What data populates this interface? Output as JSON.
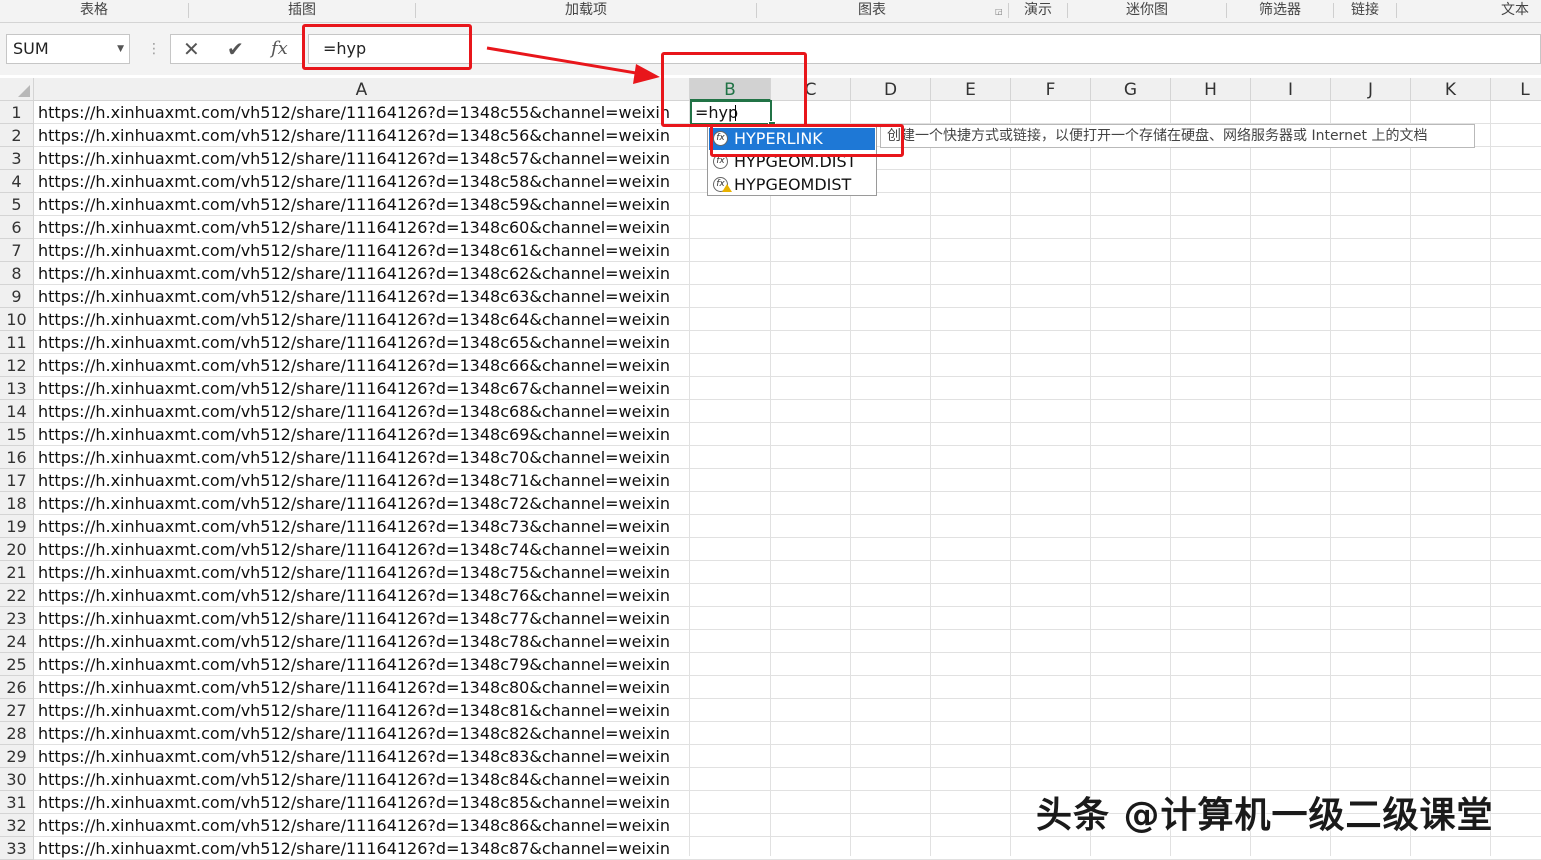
{
  "ribbon": {
    "groups": [
      {
        "label": "表格"
      },
      {
        "label": "插图"
      },
      {
        "label": "加载项"
      },
      {
        "label": "图表"
      },
      {
        "label": "演示"
      },
      {
        "label": "迷你图"
      },
      {
        "label": "筛选器"
      },
      {
        "label": "链接"
      },
      {
        "label": "文本"
      }
    ]
  },
  "formula_bar": {
    "name_box": "SUM",
    "cancel_icon": "close-icon",
    "enter_icon": "checkmark-icon",
    "function_icon": "fx-icon",
    "fx_label": "fx",
    "formula": "=hyp"
  },
  "sheet": {
    "columns": [
      "A",
      "B",
      "C",
      "D",
      "E",
      "F",
      "G",
      "H",
      "I",
      "J",
      "K",
      "L"
    ],
    "selected_column": "B",
    "active_cell": "B1",
    "active_cell_value": "=hyp",
    "rows": [
      {
        "num": "1",
        "a": "https://h.xinhuaxmt.com/vh512/share/11164126?d=1348c55&channel=weixin"
      },
      {
        "num": "2",
        "a": "https://h.xinhuaxmt.com/vh512/share/11164126?d=1348c56&channel=weixin"
      },
      {
        "num": "3",
        "a": "https://h.xinhuaxmt.com/vh512/share/11164126?d=1348c57&channel=weixin"
      },
      {
        "num": "4",
        "a": "https://h.xinhuaxmt.com/vh512/share/11164126?d=1348c58&channel=weixin"
      },
      {
        "num": "5",
        "a": "https://h.xinhuaxmt.com/vh512/share/11164126?d=1348c59&channel=weixin"
      },
      {
        "num": "6",
        "a": "https://h.xinhuaxmt.com/vh512/share/11164126?d=1348c60&channel=weixin"
      },
      {
        "num": "7",
        "a": "https://h.xinhuaxmt.com/vh512/share/11164126?d=1348c61&channel=weixin"
      },
      {
        "num": "8",
        "a": "https://h.xinhuaxmt.com/vh512/share/11164126?d=1348c62&channel=weixin"
      },
      {
        "num": "9",
        "a": "https://h.xinhuaxmt.com/vh512/share/11164126?d=1348c63&channel=weixin"
      },
      {
        "num": "10",
        "a": "https://h.xinhuaxmt.com/vh512/share/11164126?d=1348c64&channel=weixin"
      },
      {
        "num": "11",
        "a": "https://h.xinhuaxmt.com/vh512/share/11164126?d=1348c65&channel=weixin"
      },
      {
        "num": "12",
        "a": "https://h.xinhuaxmt.com/vh512/share/11164126?d=1348c66&channel=weixin"
      },
      {
        "num": "13",
        "a": "https://h.xinhuaxmt.com/vh512/share/11164126?d=1348c67&channel=weixin"
      },
      {
        "num": "14",
        "a": "https://h.xinhuaxmt.com/vh512/share/11164126?d=1348c68&channel=weixin"
      },
      {
        "num": "15",
        "a": "https://h.xinhuaxmt.com/vh512/share/11164126?d=1348c69&channel=weixin"
      },
      {
        "num": "16",
        "a": "https://h.xinhuaxmt.com/vh512/share/11164126?d=1348c70&channel=weixin"
      },
      {
        "num": "17",
        "a": "https://h.xinhuaxmt.com/vh512/share/11164126?d=1348c71&channel=weixin"
      },
      {
        "num": "18",
        "a": "https://h.xinhuaxmt.com/vh512/share/11164126?d=1348c72&channel=weixin"
      },
      {
        "num": "19",
        "a": "https://h.xinhuaxmt.com/vh512/share/11164126?d=1348c73&channel=weixin"
      },
      {
        "num": "20",
        "a": "https://h.xinhuaxmt.com/vh512/share/11164126?d=1348c74&channel=weixin"
      },
      {
        "num": "21",
        "a": "https://h.xinhuaxmt.com/vh512/share/11164126?d=1348c75&channel=weixin"
      },
      {
        "num": "22",
        "a": "https://h.xinhuaxmt.com/vh512/share/11164126?d=1348c76&channel=weixin"
      },
      {
        "num": "23",
        "a": "https://h.xinhuaxmt.com/vh512/share/11164126?d=1348c77&channel=weixin"
      },
      {
        "num": "24",
        "a": "https://h.xinhuaxmt.com/vh512/share/11164126?d=1348c78&channel=weixin"
      },
      {
        "num": "25",
        "a": "https://h.xinhuaxmt.com/vh512/share/11164126?d=1348c79&channel=weixin"
      },
      {
        "num": "26",
        "a": "https://h.xinhuaxmt.com/vh512/share/11164126?d=1348c80&channel=weixin"
      },
      {
        "num": "27",
        "a": "https://h.xinhuaxmt.com/vh512/share/11164126?d=1348c81&channel=weixin"
      },
      {
        "num": "28",
        "a": "https://h.xinhuaxmt.com/vh512/share/11164126?d=1348c82&channel=weixin"
      },
      {
        "num": "29",
        "a": "https://h.xinhuaxmt.com/vh512/share/11164126?d=1348c83&channel=weixin"
      },
      {
        "num": "30",
        "a": "https://h.xinhuaxmt.com/vh512/share/11164126?d=1348c84&channel=weixin"
      },
      {
        "num": "31",
        "a": "https://h.xinhuaxmt.com/vh512/share/11164126?d=1348c85&channel=weixin"
      },
      {
        "num": "32",
        "a": "https://h.xinhuaxmt.com/vh512/share/11164126?d=1348c86&channel=weixin"
      },
      {
        "num": "33",
        "a": "https://h.xinhuaxmt.com/vh512/share/11164126?d=1348c87&channel=weixin"
      }
    ]
  },
  "autocomplete": {
    "items": [
      {
        "label": "HYPERLINK",
        "highlighted": true,
        "icon": "function-icon"
      },
      {
        "label": "HYPGEOM.DIST",
        "highlighted": false,
        "icon": "function-icon"
      },
      {
        "label": "HYPGEOMDIST",
        "highlighted": false,
        "icon": "function-warning-icon"
      }
    ],
    "tooltip": "创建一个快捷方式或链接，以便打开一个存储在硬盘、网络服务器或 Internet 上的文档"
  },
  "annotations": {
    "color": "#e8161b"
  },
  "watermark": "头条 @计算机一级二级课堂",
  "colors": {
    "excel_green": "#217346",
    "highlight_blue": "#1e78d6"
  }
}
